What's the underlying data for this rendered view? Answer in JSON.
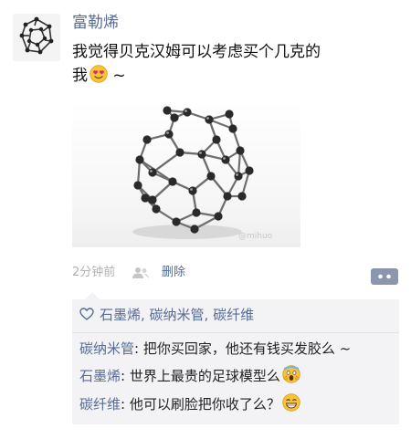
{
  "post": {
    "author": "富勒烯",
    "text_line1": "我觉得贝克汉姆可以考虑买个几克的",
    "text_line2": "我",
    "text_suffix": " ~",
    "image_watermark": "@mihuo",
    "time": "2分钟前",
    "delete_label": "删除"
  },
  "likes": {
    "names": "石墨烯, 碳纳米管, 碳纤维"
  },
  "comments": [
    {
      "author": "碳纳米管",
      "text": "把你买回家，他还有钱买发胶么 ~"
    },
    {
      "author": "石墨烯",
      "text": "世界上最贵的足球模型么"
    },
    {
      "author": "碳纤维",
      "text": "他可以刷脸把你收了么？"
    }
  ],
  "colors": {
    "link": "#576b95",
    "comment_bg": "#f3f3f5",
    "time": "#b2b2b2"
  }
}
